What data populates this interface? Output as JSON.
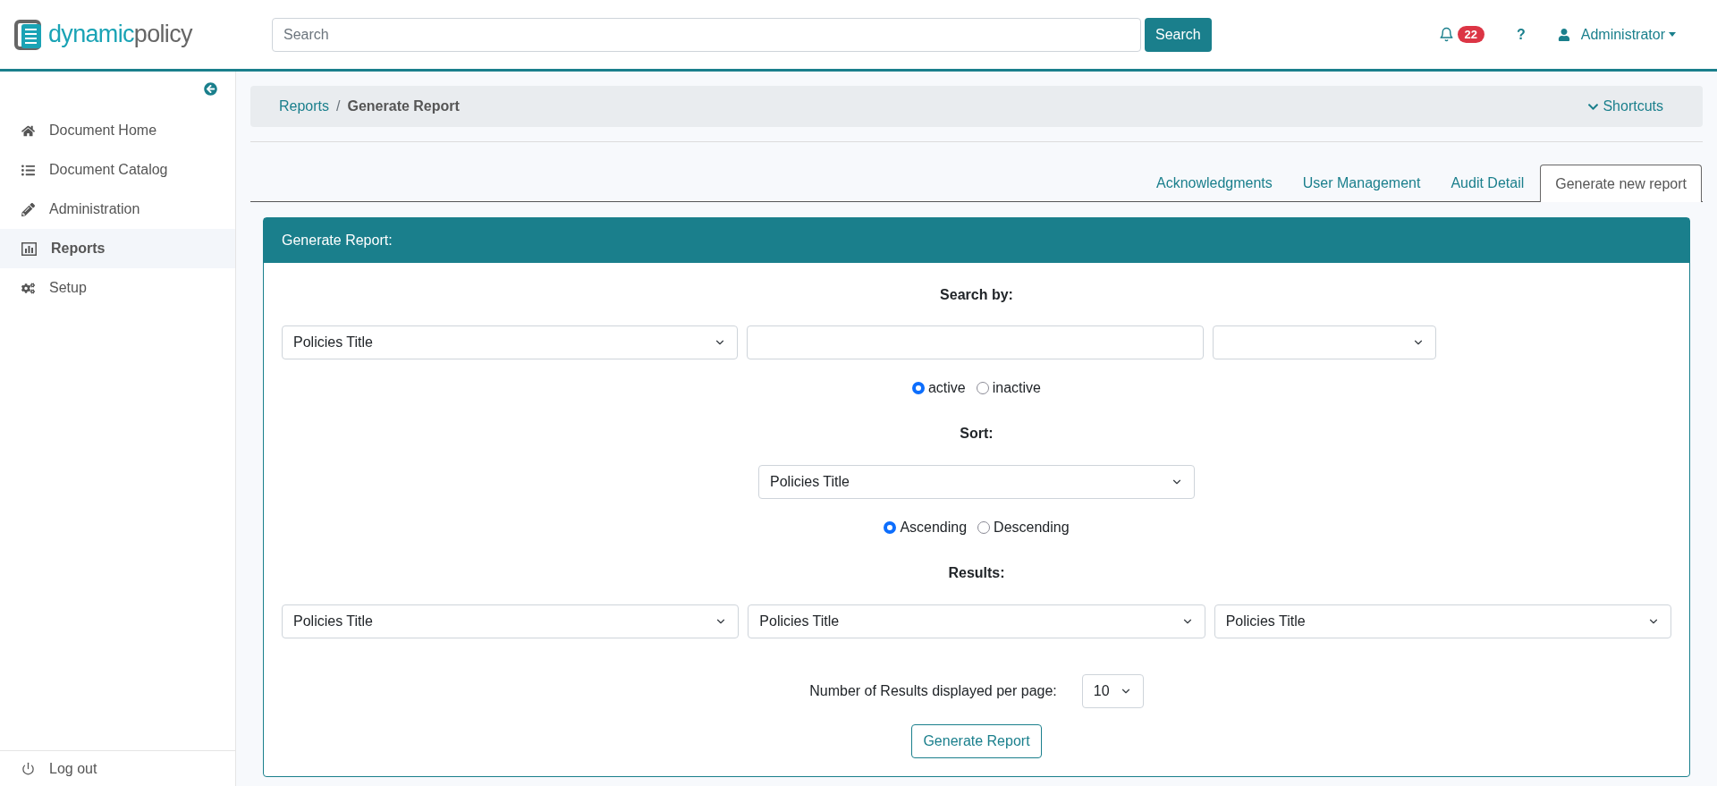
{
  "header": {
    "logo": {
      "part1": "dynamic",
      "part2": "policy"
    },
    "search": {
      "placeholder": "Search",
      "button": "Search"
    },
    "notifications": "22",
    "help": "?",
    "user": "Administrator"
  },
  "sidebar": {
    "items": [
      {
        "label": "Document Home",
        "selected": false
      },
      {
        "label": "Document Catalog",
        "selected": false
      },
      {
        "label": "Administration",
        "selected": false
      },
      {
        "label": "Reports",
        "selected": true
      },
      {
        "label": "Setup",
        "selected": false
      }
    ],
    "logout": "Log out"
  },
  "breadcrumb": {
    "link": "Reports",
    "separator": "/",
    "current": "Generate Report",
    "shortcuts": "Shortcuts"
  },
  "tabs": [
    {
      "label": "Acknowledgments",
      "selected": false
    },
    {
      "label": "User Management",
      "selected": false
    },
    {
      "label": "Audit Detail",
      "selected": false
    },
    {
      "label": "Generate new report",
      "selected": true
    }
  ],
  "card": {
    "title": "Generate Report:",
    "search_by": {
      "label": "Search by:",
      "field_select": "Policies Title",
      "status_options": [
        {
          "label": "active",
          "selected": true
        },
        {
          "label": "inactive",
          "selected": false
        }
      ]
    },
    "sort": {
      "label": "Sort:",
      "select": "Policies Title",
      "order_options": [
        {
          "label": "Ascending",
          "selected": true
        },
        {
          "label": "Descending",
          "selected": false
        }
      ]
    },
    "results": {
      "label": "Results:",
      "selects": [
        "Policies Title",
        "Policies Title",
        "Policies Title"
      ]
    },
    "per_page": {
      "label": "Number of Results displayed per page:",
      "value": "10"
    },
    "button": "Generate Report"
  }
}
